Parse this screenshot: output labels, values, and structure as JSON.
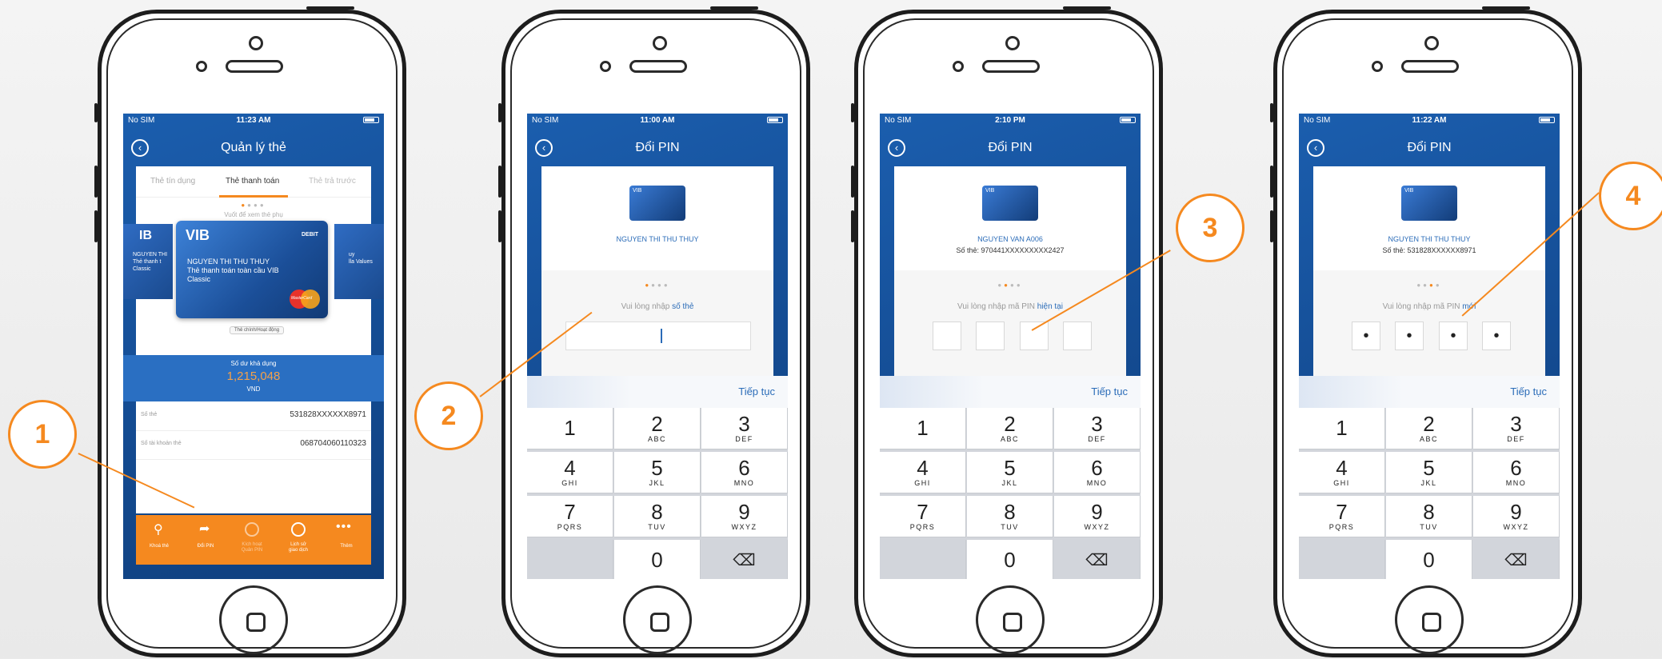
{
  "status": {
    "carrier": "No SIM",
    "times": [
      "11:23 AM",
      "11:00 AM",
      "2:10 PM",
      "11:22 AM"
    ]
  },
  "screen1": {
    "title": "Quản lý thẻ",
    "tabs": [
      "Thẻ tín dụng",
      "Thẻ thanh toán",
      "Thẻ trả trước"
    ],
    "swipe_hint": "Vuốt để xem thẻ phụ",
    "card": {
      "brand": "VIB",
      "type": "DEBIT",
      "holder": "NGUYEN THI THU THUY",
      "product": "Thẻ thanh toán toàn cầu VIB Classic",
      "network": "MasterCard",
      "left_peek": "NGUYEN THI\nThẻ thanh t\nClassic",
      "right_peek": "uy\nlla Values"
    },
    "card_status": "Thẻ chính/Hoạt động",
    "balance_label": "Số dư khả dụng",
    "balance_value": "1,215,048",
    "currency": "VND",
    "rows": [
      {
        "label": "Số thẻ",
        "value": "531828XXXXXX8971"
      },
      {
        "label": "Số tài khoản thẻ",
        "value": "068704060110323"
      }
    ],
    "actions": [
      {
        "label": "Khoá thẻ",
        "icon": "key-icon"
      },
      {
        "label": "Đổi PIN",
        "icon": "share-icon"
      },
      {
        "label": "Kích hoạt Quản PIN",
        "icon": "card-icon"
      },
      {
        "label": "Lịch sử giao dịch",
        "icon": "history-icon"
      },
      {
        "label": "Thêm",
        "icon": "more-icon"
      }
    ]
  },
  "pin_title": "Đổi PIN",
  "screen2": {
    "name": "NGUYEN THI THU THUY",
    "prompt_prefix": "Vui lòng nhập",
    "prompt_hl": "số thẻ"
  },
  "screen3": {
    "name": "NGUYEN VAN A006",
    "card_no": "Số thẻ: 970441XXXXXXXXX2427",
    "prompt_prefix": "Vui lòng nhập mã PIN",
    "prompt_hl": "hiện tại"
  },
  "screen4": {
    "name": "NGUYEN THI THU THUY",
    "card_no": "Số thẻ: 531828XXXXXX8971",
    "prompt_prefix": "Vui lòng nhập mã PIN",
    "prompt_hl": "mới",
    "pin_dots": [
      "•",
      "•",
      "•",
      "•"
    ]
  },
  "continue_label": "Tiếp tục",
  "keypad": [
    {
      "n": "1",
      "s": ""
    },
    {
      "n": "2",
      "s": "ABC"
    },
    {
      "n": "3",
      "s": "DEF"
    },
    {
      "n": "4",
      "s": "GHI"
    },
    {
      "n": "5",
      "s": "JKL"
    },
    {
      "n": "6",
      "s": "MNO"
    },
    {
      "n": "7",
      "s": "PQRS"
    },
    {
      "n": "8",
      "s": "TUV"
    },
    {
      "n": "9",
      "s": "WXYZ"
    },
    {
      "n": "",
      "s": ""
    },
    {
      "n": "0",
      "s": ""
    },
    {
      "n": "⌫",
      "s": ""
    }
  ],
  "steps": [
    "1",
    "2",
    "3",
    "4"
  ],
  "colors": {
    "accent": "#f5891f",
    "brand_blue": "#1b5eae",
    "link": "#2b6cb8"
  }
}
